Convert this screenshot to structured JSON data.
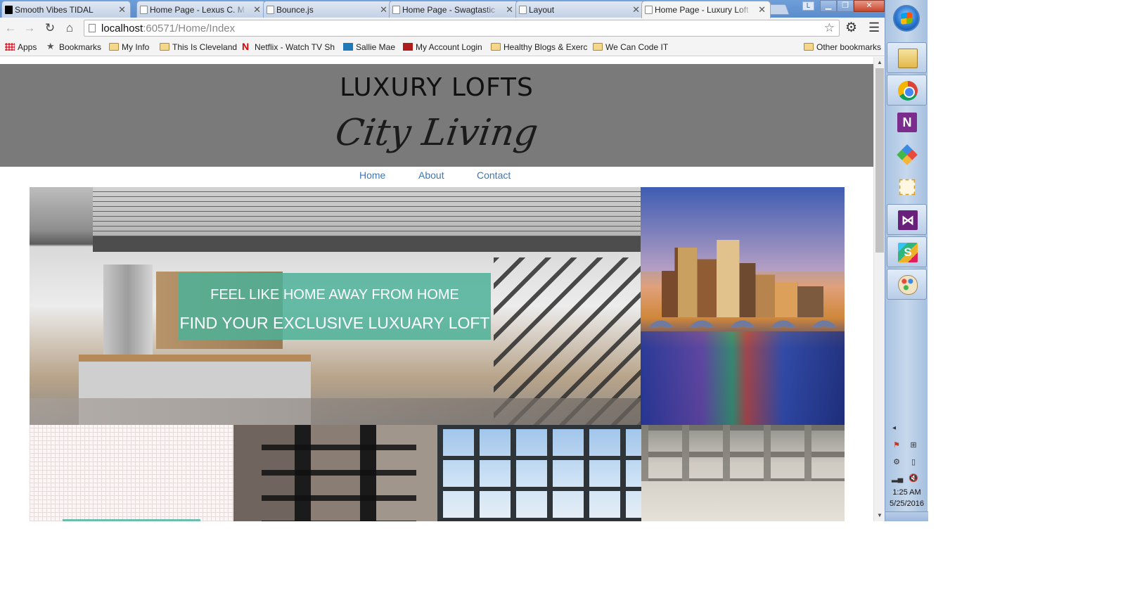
{
  "browser": {
    "tabs": [
      {
        "title": "Smooth Vibes TIDAL",
        "active": false
      },
      {
        "title": "Home Page - Lexus C. M",
        "active": false
      },
      {
        "title": "Bounce.js",
        "active": false
      },
      {
        "title": "Home Page - Swagtastic",
        "active": false
      },
      {
        "title": "Layout",
        "active": false
      },
      {
        "title": "Home Page - Luxury Loft",
        "active": true
      }
    ],
    "tab_close_glyph": "✕",
    "profile_badge": "L",
    "url_host": "localhost",
    "url_rest": ":60571/Home/Index",
    "bookmarks": [
      {
        "label": "Apps",
        "icon": "apps-grid-icon"
      },
      {
        "label": "Bookmarks",
        "icon": "star-icon"
      },
      {
        "label": "My Info",
        "icon": "folder-icon"
      },
      {
        "label": "This Is Cleveland",
        "icon": "folder-icon"
      },
      {
        "label": "Netflix - Watch TV Sh",
        "icon": "netflix-icon"
      },
      {
        "label": "Sallie Mae",
        "icon": "sallie-mae-icon"
      },
      {
        "label": "My Account Login",
        "icon": "account-icon"
      },
      {
        "label": "Healthy Blogs & Exerc",
        "icon": "folder-icon"
      },
      {
        "label": "We Can Code IT",
        "icon": "folder-icon"
      },
      {
        "label": "Other bookmarks",
        "icon": "folder-icon"
      }
    ]
  },
  "site": {
    "title": "LUXURY LOFTS",
    "tagline": "City Living",
    "nav": [
      "Home",
      "About",
      "Contact"
    ],
    "hero": {
      "line1": "FEEL LIKE HOME AWAY FROM HOME",
      "line2": "FIND YOUR EXCLUSIVE LUXUARY LOFT"
    }
  },
  "taskbar": {
    "pinned": [
      "windows-explorer-icon",
      "chrome-icon",
      "onenote-icon",
      "kite-app-icon",
      "snipping-tool-icon",
      "visual-studio-icon",
      "slack-icon",
      "paint-icon"
    ],
    "time": "1:25 AM",
    "date": "5/25/2016"
  },
  "colors": {
    "header_bg": "#7a7a7a",
    "nav_link": "#3b78b8",
    "hero_banner": "#4cb198",
    "taskbar": "#c6d8ec"
  }
}
